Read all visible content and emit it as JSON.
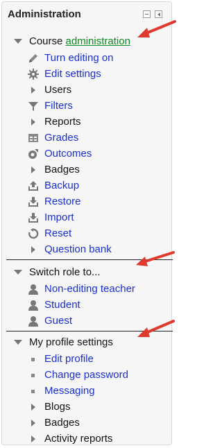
{
  "block": {
    "title": "Administration",
    "minimize_icon": "minus-icon",
    "dock_icon": "dock-icon"
  },
  "sections": {
    "course": {
      "label_prefix": "Course ",
      "label_link": "administration",
      "items": [
        {
          "label": "Turn editing on",
          "icon": "pencil-icon",
          "type": "link"
        },
        {
          "label": "Edit settings",
          "icon": "gear-icon",
          "type": "link"
        },
        {
          "label": "Users",
          "icon": "triangle-right-icon",
          "type": "branch"
        },
        {
          "label": "Filters",
          "icon": "filter-icon",
          "type": "link"
        },
        {
          "label": "Reports",
          "icon": "triangle-right-icon",
          "type": "branch"
        },
        {
          "label": "Grades",
          "icon": "grades-table-icon",
          "type": "link"
        },
        {
          "label": "Outcomes",
          "icon": "outcomes-icon",
          "type": "link"
        },
        {
          "label": "Badges",
          "icon": "triangle-right-icon",
          "type": "branch"
        },
        {
          "label": "Backup",
          "icon": "backup-upload-icon",
          "type": "link"
        },
        {
          "label": "Restore",
          "icon": "restore-download-icon",
          "type": "link"
        },
        {
          "label": "Import",
          "icon": "import-icon",
          "type": "link"
        },
        {
          "label": "Reset",
          "icon": "reset-icon",
          "type": "link"
        },
        {
          "label": "Question bank",
          "icon": "triangle-right-icon",
          "type": "branch"
        }
      ]
    },
    "switch_role": {
      "label": "Switch role to...",
      "items": [
        {
          "label": "Non-editing teacher",
          "icon": "user-icon"
        },
        {
          "label": "Student",
          "icon": "user-icon"
        },
        {
          "label": "Guest",
          "icon": "user-icon"
        }
      ]
    },
    "profile": {
      "label": "My profile settings",
      "items": [
        {
          "label": "Edit profile",
          "icon": "bullet-icon",
          "type": "link"
        },
        {
          "label": "Change password",
          "icon": "bullet-icon",
          "type": "link"
        },
        {
          "label": "Messaging",
          "icon": "bullet-icon",
          "type": "link"
        },
        {
          "label": "Blogs",
          "icon": "triangle-right-icon",
          "type": "branch"
        },
        {
          "label": "Badges",
          "icon": "triangle-right-icon",
          "type": "branch"
        },
        {
          "label": "Activity reports",
          "icon": "triangle-right-icon",
          "type": "branch"
        }
      ]
    }
  },
  "colors": {
    "link": "#1a2fd0",
    "green_link": "#0d8a20",
    "annotation_arrow": "#e03a2e"
  }
}
